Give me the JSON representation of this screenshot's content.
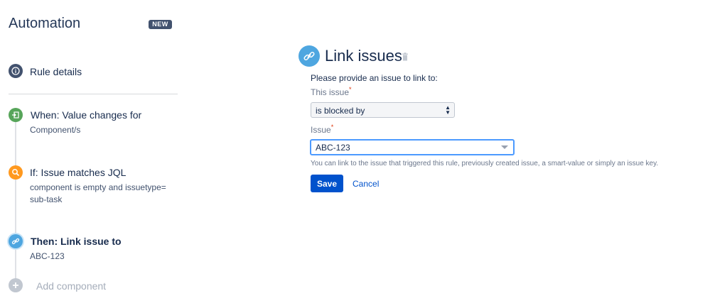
{
  "sidebar": {
    "title": "Automation",
    "badge": "NEW",
    "rule_details": "Rule details",
    "steps": [
      {
        "title": "When: Value changes for",
        "subtitle": "Component/s",
        "color": "#57a55a",
        "icon": "trigger-icon"
      },
      {
        "title": "If: Issue matches JQL",
        "subtitle": "component is empty and issuetype=\nsub-task",
        "color": "#ff991f",
        "icon": "search-icon"
      },
      {
        "title": "Then: Link issue to",
        "subtitle": "ABC-123",
        "color": "#4ea6e0",
        "icon": "link-icon"
      }
    ],
    "add_component": "Add component"
  },
  "panel": {
    "title": "Link issues",
    "prompt": "Please provide an issue to link to:",
    "this_issue_label": "This issue",
    "link_type_value": "is blocked by",
    "issue_label": "Issue",
    "issue_value": "ABC-123",
    "help": "You can link to the issue that triggered this rule, previously created issue, a smart-value or simply an issue key.",
    "save": "Save",
    "cancel": "Cancel",
    "required_marker": "*"
  },
  "colors": {
    "primary": "#0052cc",
    "focus": "#4c9aff",
    "badge": "#42526e"
  }
}
